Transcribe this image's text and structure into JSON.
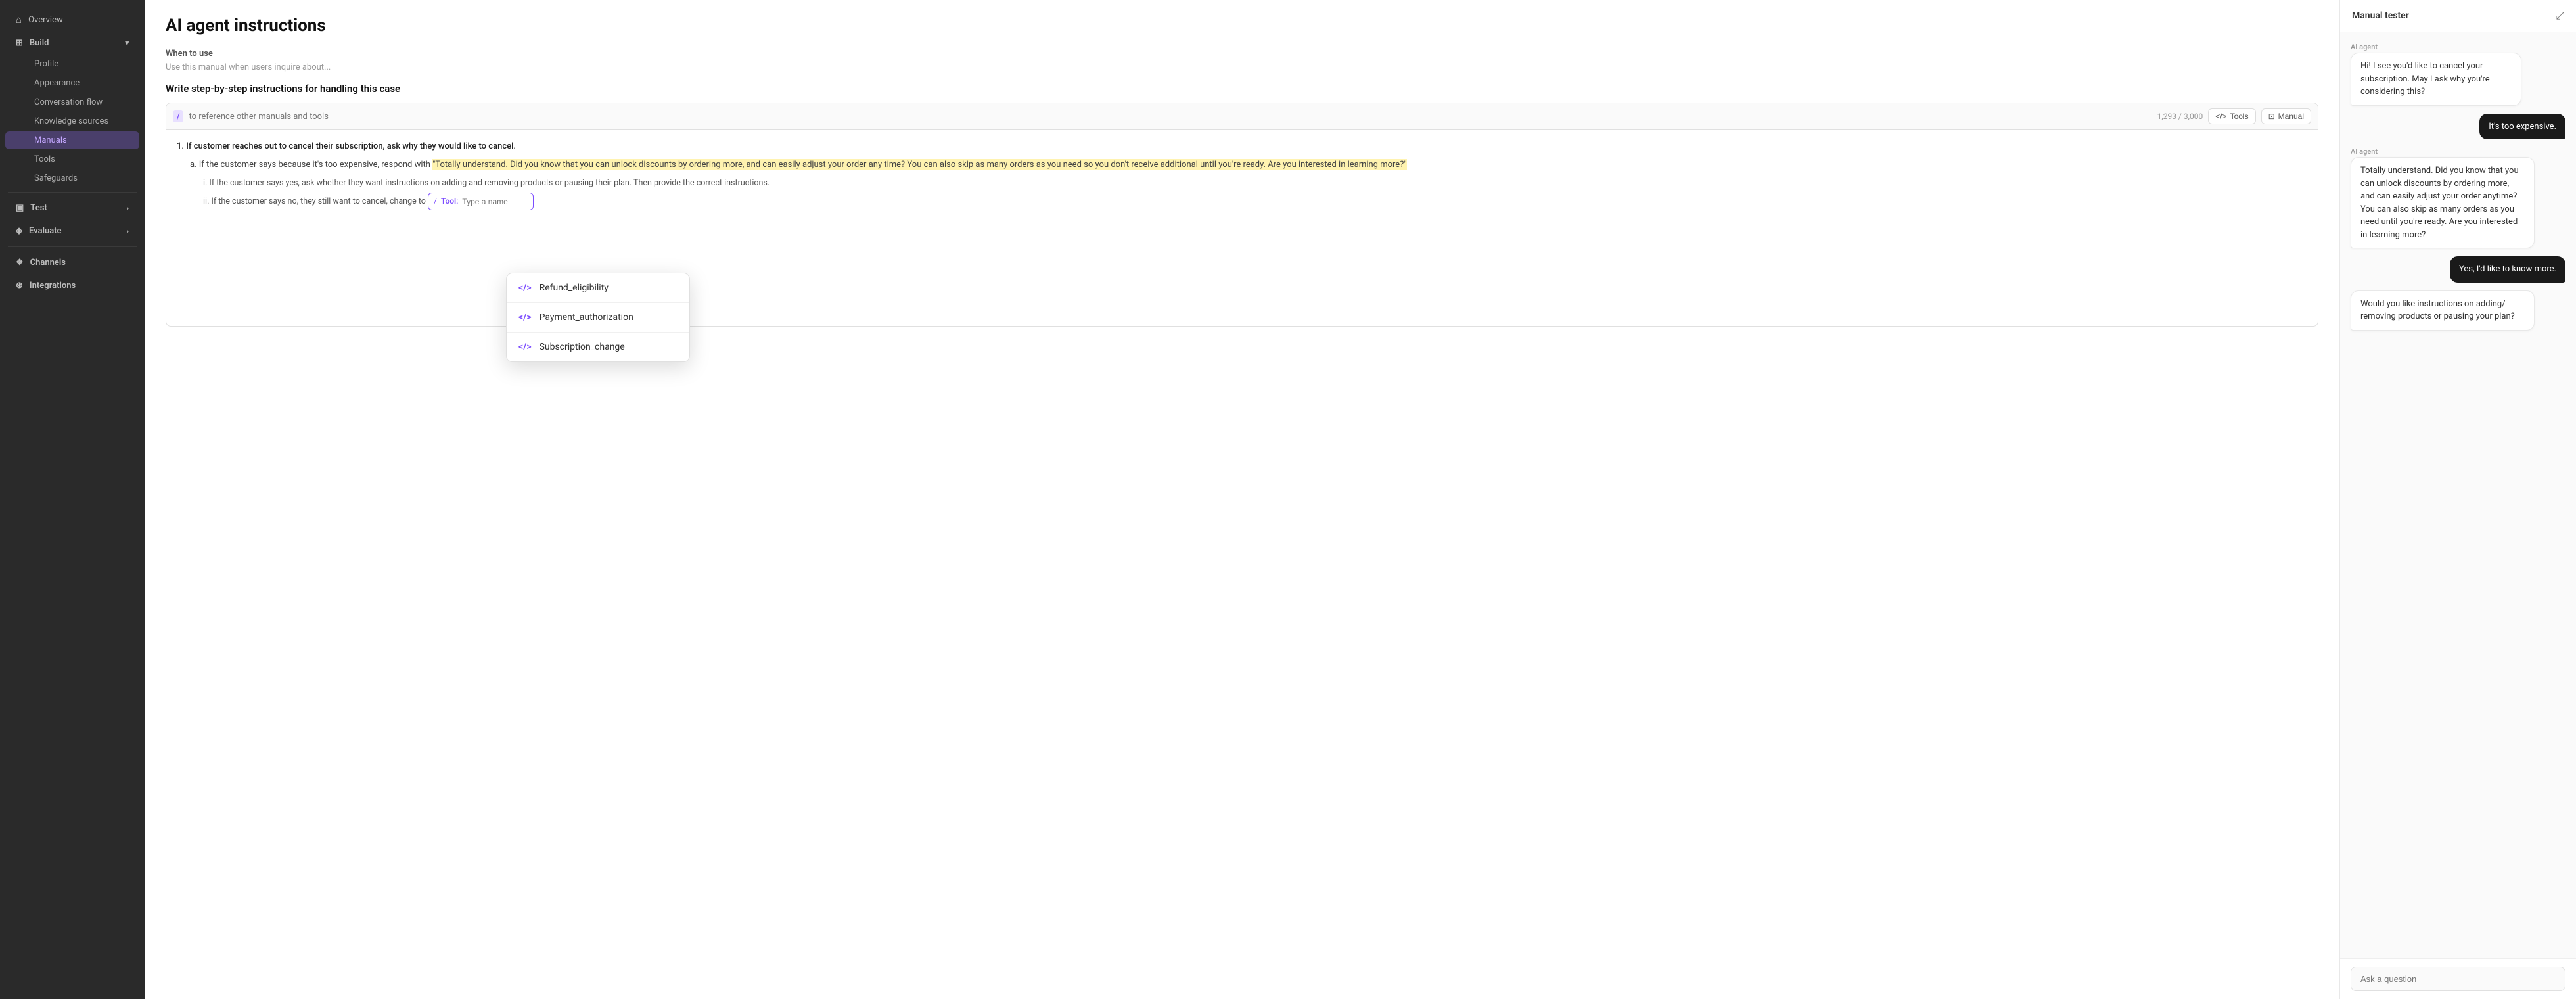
{
  "sidebar": {
    "overview_label": "Overview",
    "build_label": "Build",
    "profile_label": "Profile",
    "appearance_label": "Appearance",
    "conversation_flow_label": "Conversation flow",
    "knowledge_sources_label": "Knowledge sources",
    "manuals_label": "Manuals",
    "tools_label": "Tools",
    "safeguards_label": "Safeguards",
    "test_label": "Test",
    "evaluate_label": "Evaluate",
    "channels_label": "Channels",
    "integrations_label": "Integrations"
  },
  "main": {
    "title": "AI agent instructions",
    "when_to_use_label": "When to use",
    "when_to_use_placeholder": "Use this manual when users inquire about...",
    "write_instructions_label": "Write step-by-step instructions for handling this case",
    "slash_icon": "/",
    "toolbar_placeholder": "to reference other manuals and tools",
    "char_count": "1,293 / 3,000",
    "tools_btn": "Tools",
    "manual_btn": "Manual",
    "item1_text": "1. If customer reaches out to cancel their subscription, ask why they would like to cancel.",
    "sub_a_prefix": "a. If the customer says because it's too expensive, respond with ",
    "sub_a_quote": "\"Totally understand. Did you know that you can unlock discounts by ordering more, and can easily adjust your order any time? You can also skip as many orders as you need so you don't receive additional until you're ready. Are you interested in learning more?\"",
    "sub_i_text": "i. If the customer says yes, ask whether they want instructions on adding and removing products or pausing their plan. Then provide the correct instructions.",
    "sub_ii_prefix": "ii. If the customer says no, they still want to cancel, change to ",
    "tool_input_slash": "/",
    "tool_input_label": "Tool:",
    "tool_input_placeholder": "Type a name"
  },
  "dropdown": {
    "items": [
      {
        "icon": "</>",
        "label": "Refund_eligibility"
      },
      {
        "icon": "</>",
        "label": "Payment_authorization"
      },
      {
        "icon": "</>",
        "label": "Subscription_change"
      }
    ]
  },
  "right_panel": {
    "title": "Manual tester",
    "expand_icon": "⤢",
    "chat": [
      {
        "type": "agent",
        "label": "AI agent",
        "text": "Hi! I see you'd like to cancel your subscription. May I ask why you're considering this?"
      },
      {
        "type": "user",
        "text": "It's too expensive."
      },
      {
        "type": "agent",
        "label": "AI agent",
        "text": "Totally understand. Did you know that you can unlock discounts by ordering more, and can easily adjust your order anytime? You can also skip as many orders as you need until you're ready. Are you interested in learning more?"
      },
      {
        "type": "user",
        "text": "Yes, I'd like to know more."
      },
      {
        "type": "agent_partial",
        "text": "Would you like instructions on adding/ removing products or pausing your plan?"
      }
    ],
    "input_placeholder": "Ask a question"
  },
  "colors": {
    "accent_purple": "#7c4dff",
    "highlight_yellow": "#fff3b0",
    "sidebar_bg": "#2a2a2a",
    "active_sidebar": "#4a3f6b"
  }
}
